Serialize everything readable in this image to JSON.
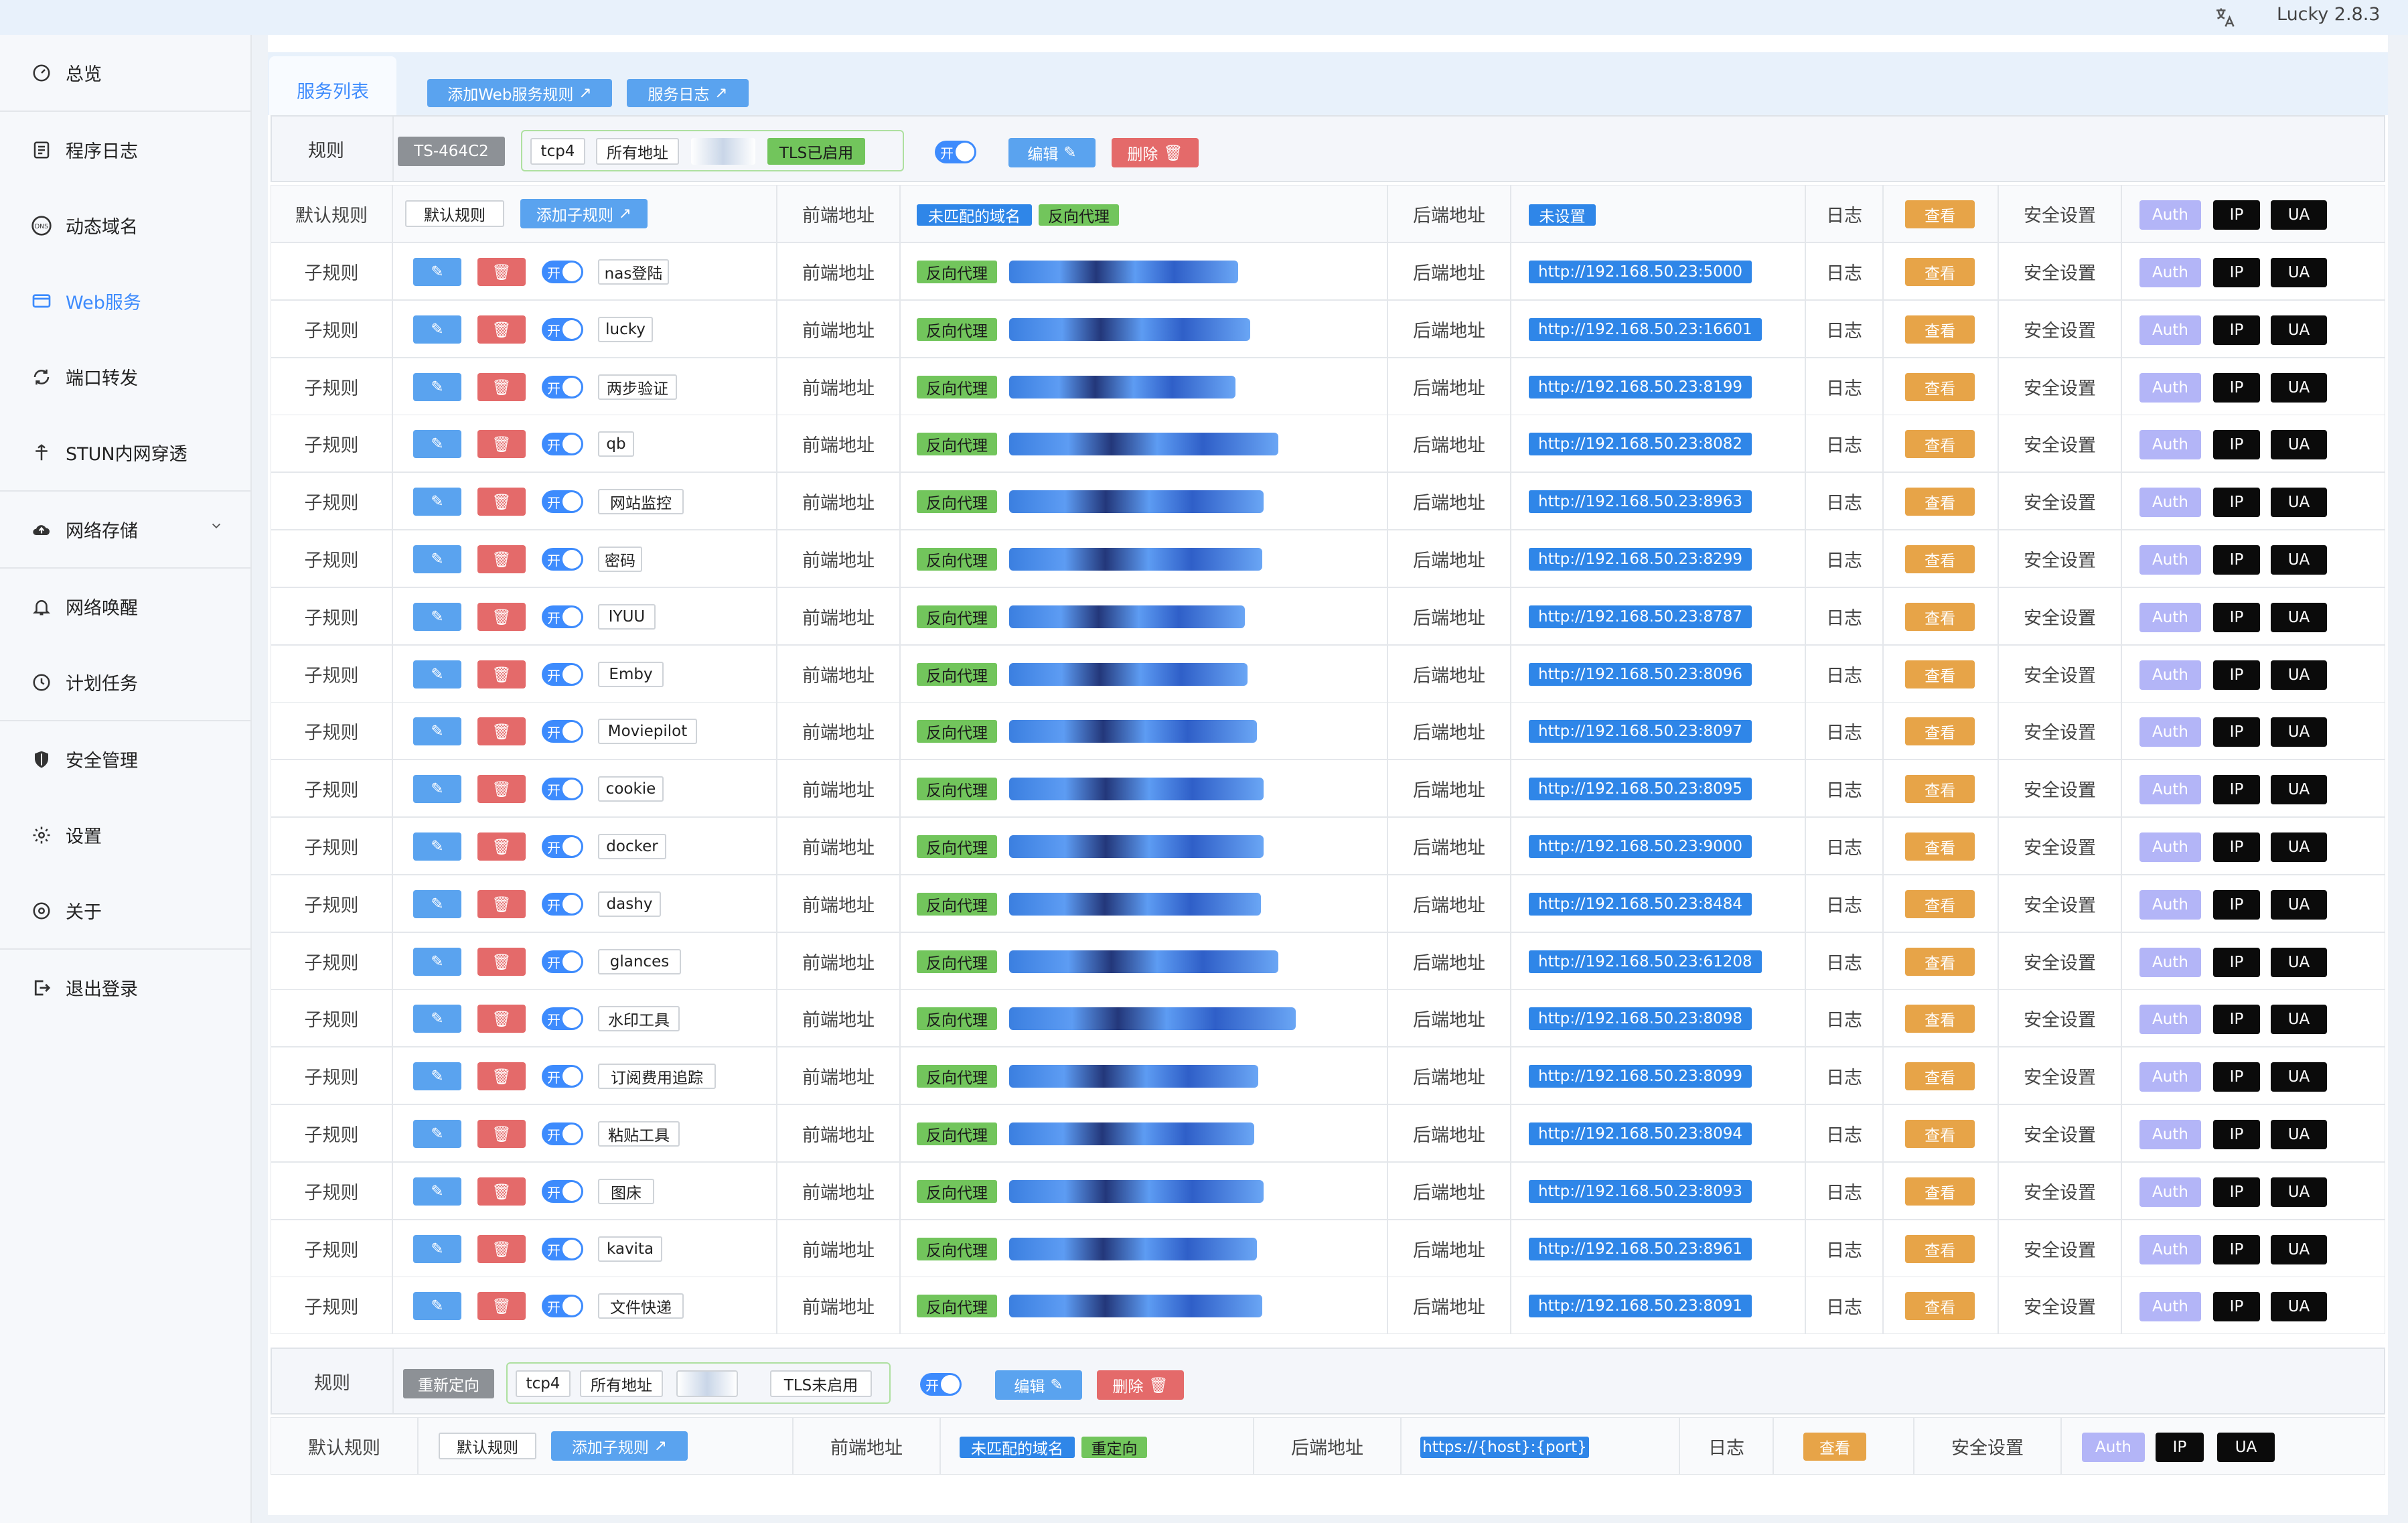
{
  "app": {
    "version": "Lucky 2.8.3",
    "lang_icon": "translate-icon"
  },
  "sidebar": {
    "items": [
      {
        "label": "总览",
        "icon": "dashboard-icon"
      },
      {
        "label": "程序日志",
        "icon": "log-icon"
      },
      {
        "label": "动态域名",
        "icon": "dns-icon"
      },
      {
        "label": "Web服务",
        "icon": "web-service-icon",
        "active": true
      },
      {
        "label": "端口转发",
        "icon": "port-forward-icon"
      },
      {
        "label": "STUN内网穿透",
        "icon": "stun-icon"
      },
      {
        "label": "网络存储",
        "icon": "cloud-storage-icon",
        "has_submenu": true
      },
      {
        "label": "网络唤醒",
        "icon": "bell-icon"
      },
      {
        "label": "计划任务",
        "icon": "clock-icon"
      },
      {
        "label": "安全管理",
        "icon": "shield-icon"
      },
      {
        "label": "设置",
        "icon": "gear-icon"
      },
      {
        "label": "关于",
        "icon": "about-icon"
      },
      {
        "label": "退出登录",
        "icon": "logout-icon"
      }
    ]
  },
  "tabs": {
    "active": "服务列表",
    "add_rule": "添加Web服务规则",
    "service_log": "服务日志"
  },
  "rule1": {
    "label": "规则",
    "name": "TS-464C2",
    "protocol": "tcp4",
    "address": "所有地址",
    "tls": "TLS已启用",
    "toggle": "开",
    "edit": "编辑",
    "delete": "删除",
    "default_row": {
      "label": "默认规则",
      "name": "默认规则",
      "add_sub": "添加子规则",
      "frontend_label": "前端地址",
      "frontend_tags": [
        "未匹配的域名",
        "反向代理"
      ],
      "backend_label": "后端地址",
      "backend": "未设置",
      "log_label": "日志",
      "view": "查看",
      "security_label": "安全设置",
      "auth": "Auth",
      "ip": "IP",
      "ua": "UA"
    },
    "sub_common": {
      "label": "子规则",
      "toggle": "开",
      "frontend_label": "前端地址",
      "proxy": "反向代理",
      "backend_label": "后端地址",
      "log_label": "日志",
      "view": "查看",
      "security_label": "安全设置",
      "auth": "Auth",
      "ip": "IP",
      "ua": "UA"
    },
    "subrules": [
      {
        "name": "nas登陆",
        "backend": "http://192.168.50.23:5000"
      },
      {
        "name": "lucky",
        "backend": "http://192.168.50.23:16601"
      },
      {
        "name": "两步验证",
        "backend": "http://192.168.50.23:8199"
      },
      {
        "name": "qb",
        "backend": "http://192.168.50.23:8082"
      },
      {
        "name": "网站监控",
        "backend": "http://192.168.50.23:8963"
      },
      {
        "name": "密码",
        "backend": "http://192.168.50.23:8299"
      },
      {
        "name": "IYUU",
        "backend": "http://192.168.50.23:8787"
      },
      {
        "name": "Emby",
        "backend": "http://192.168.50.23:8096"
      },
      {
        "name": "Moviepilot",
        "backend": "http://192.168.50.23:8097"
      },
      {
        "name": "cookie",
        "backend": "http://192.168.50.23:8095"
      },
      {
        "name": "docker",
        "backend": "http://192.168.50.23:9000"
      },
      {
        "name": "dashy",
        "backend": "http://192.168.50.23:8484"
      },
      {
        "name": "glances",
        "backend": "http://192.168.50.23:61208"
      },
      {
        "name": "水印工具",
        "backend": "http://192.168.50.23:8098"
      },
      {
        "name": "订阅费用追踪",
        "backend": "http://192.168.50.23:8099"
      },
      {
        "name": "粘贴工具",
        "backend": "http://192.168.50.23:8094"
      },
      {
        "name": "图床",
        "backend": "http://192.168.50.23:8093"
      },
      {
        "name": "kavita",
        "backend": "http://192.168.50.23:8961"
      },
      {
        "name": "文件快递",
        "backend": "http://192.168.50.23:8091"
      }
    ]
  },
  "rule2": {
    "label": "规则",
    "name": "重新定向",
    "protocol": "tcp4",
    "address": "所有地址",
    "tls": "TLS未启用",
    "toggle": "开",
    "edit": "编辑",
    "delete": "删除",
    "default_row": {
      "label": "默认规则",
      "name": "默认规则",
      "add_sub": "添加子规则",
      "frontend_label": "前端地址",
      "frontend_tags": [
        "未匹配的域名",
        "重定向"
      ],
      "backend_label": "后端地址",
      "backend": "https://{host}:{port}",
      "log_label": "日志",
      "view": "查看",
      "security_label": "安全设置",
      "auth": "Auth",
      "ip": "IP",
      "ua": "UA"
    }
  },
  "colors": {
    "accent": "#3d8bfd",
    "danger": "#e46a6a",
    "success": "#72c55c",
    "warning": "#e7a448",
    "auth": "#b3b5f7"
  }
}
